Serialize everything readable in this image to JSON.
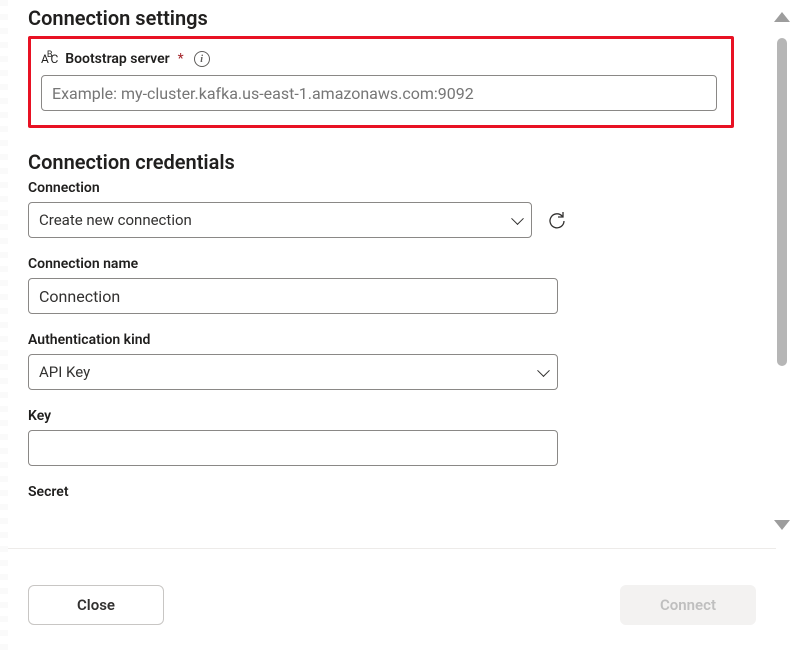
{
  "sections": {
    "settings_title": "Connection settings",
    "credentials_title": "Connection credentials"
  },
  "bootstrap": {
    "label": "Bootstrap server",
    "placeholder": "Example: my-cluster.kafka.us-east-1.amazonaws.com:9092",
    "value": ""
  },
  "connection": {
    "label": "Connection",
    "selected": "Create new connection"
  },
  "connection_name": {
    "label": "Connection name",
    "value": "Connection"
  },
  "auth_kind": {
    "label": "Authentication kind",
    "selected": "API Key"
  },
  "key": {
    "label": "Key",
    "value": ""
  },
  "secret": {
    "label": "Secret",
    "value": ""
  },
  "footer": {
    "close": "Close",
    "connect": "Connect"
  }
}
